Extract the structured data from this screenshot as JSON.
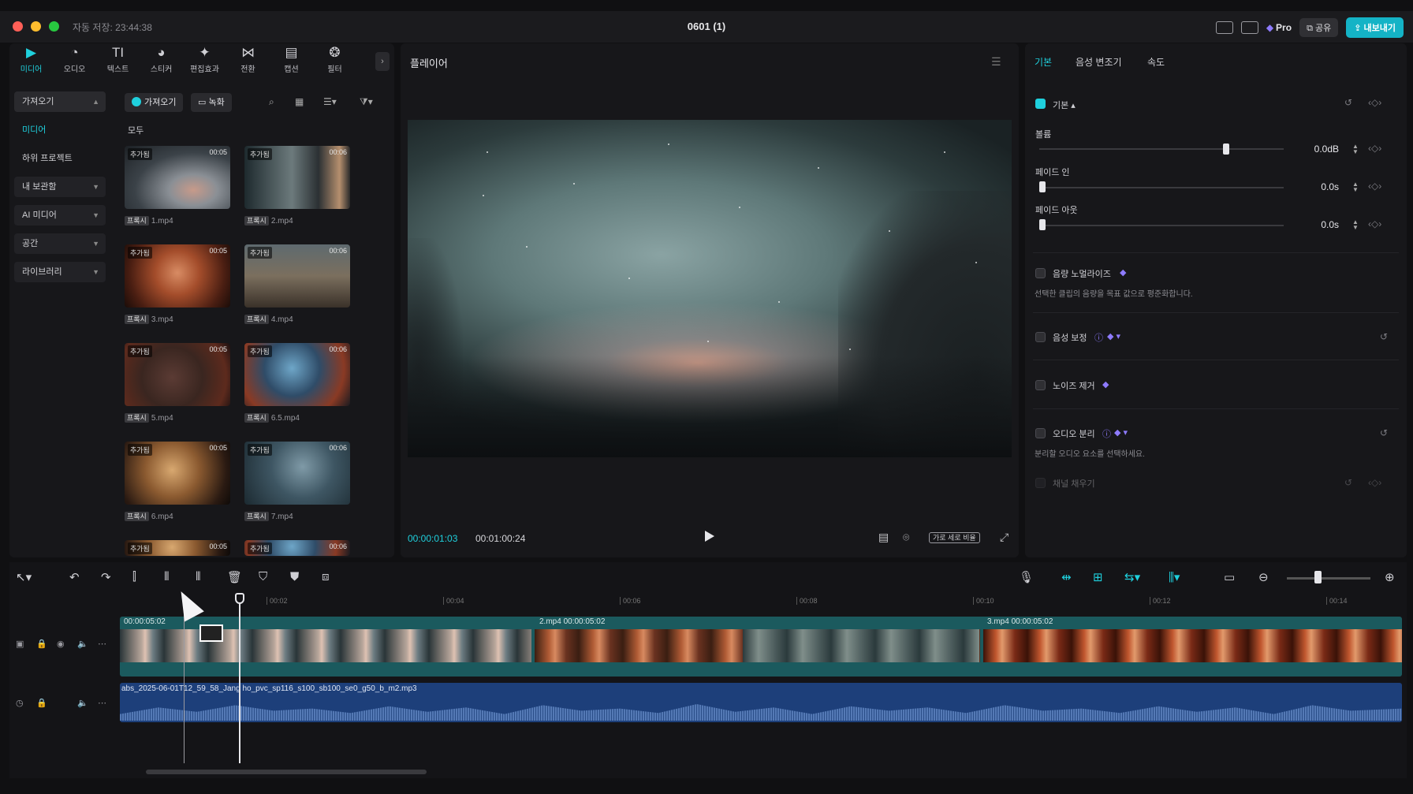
{
  "titlebar": {
    "autosave": "자동 저장: 23:44:38",
    "title": "0601 (1)",
    "pro": "Pro",
    "share": "공유",
    "export": "내보내기"
  },
  "tools": [
    {
      "label": "미디어",
      "icon": "▶"
    },
    {
      "label": "오디오",
      "icon": "◔"
    },
    {
      "label": "텍스트",
      "icon": "TI"
    },
    {
      "label": "스티커",
      "icon": "◕"
    },
    {
      "label": "편집효과",
      "icon": "✦"
    },
    {
      "label": "전환",
      "icon": "⋈"
    },
    {
      "label": "캡션",
      "icon": "▤"
    },
    {
      "label": "필터",
      "icon": "❂"
    }
  ],
  "nav": {
    "import": "가져오기",
    "media": "미디어",
    "sub_project": "하위 프로젝트",
    "my_library": "내 보관함",
    "ai_media": "AI 미디어",
    "space": "공간",
    "library": "라이브러리"
  },
  "media_head": {
    "import_btn": "가져오기",
    "record_btn": "녹화",
    "filter_all": "모두"
  },
  "media_items": [
    {
      "badge": "추가됨",
      "duration": "00:05",
      "tag": "프록시",
      "name": "1.mp4"
    },
    {
      "badge": "추가됨",
      "duration": "00:06",
      "tag": "프록시",
      "name": "2.mp4"
    },
    {
      "badge": "추가됨",
      "duration": "00:05",
      "tag": "프록시",
      "name": "3.mp4"
    },
    {
      "badge": "추가됨",
      "duration": "00:06",
      "tag": "프록시",
      "name": "4.mp4"
    },
    {
      "badge": "추가됨",
      "duration": "00:05",
      "tag": "프록시",
      "name": "5.mp4"
    },
    {
      "badge": "추가됨",
      "duration": "00:06",
      "tag": "프록시",
      "name": "6.5.mp4"
    },
    {
      "badge": "추가됨",
      "duration": "00:05",
      "tag": "프록시",
      "name": "6.mp4"
    },
    {
      "badge": "추가됨",
      "duration": "00:06",
      "tag": "프록시",
      "name": "7.mp4"
    },
    {
      "badge": "추가됨",
      "duration": "00:05"
    },
    {
      "badge": "추가됨",
      "duration": "00:06"
    }
  ],
  "player": {
    "title": "플레이어",
    "current_time": "00:00:01:03",
    "total_time": "00:01:00:24",
    "ratio": "가로 세로 비율"
  },
  "right": {
    "tabs": [
      "기본",
      "음성 변조기",
      "속도"
    ],
    "basic_label": "기본",
    "volume_label": "볼륨",
    "volume_value": "0.0dB",
    "fade_in_label": "페이드 인",
    "fade_in_value": "0.0s",
    "fade_out_label": "페이드 아웃",
    "fade_out_value": "0.0s",
    "normalize_label": "음량 노멀라이즈",
    "normalize_desc": "선택한 클립의 음량을 목표 값으로 평준화합니다.",
    "voice_enhance_label": "음성 보정",
    "noise_label": "노이즈 제거",
    "audio_sep_label": "오디오 분리",
    "audio_sep_desc": "분리할 오디오 요소를 선택하세요.",
    "channel_label": "채널 채우기",
    "volume_level": 0.75,
    "fade_in_level": 0,
    "fade_out_level": 0
  },
  "timeline": {
    "ticks": [
      "00:02",
      "00:04",
      "00:06",
      "00:08",
      "00:10",
      "00:12",
      "00:14"
    ],
    "clip1_hdr": "00:00:05:02",
    "clip2_hdr": "2.mp4  00:00:05:02",
    "clip3_hdr": "3.mp4  00:00:05:02",
    "audio_name": "abs_2025-06-01T12_59_58_Jang ho_pvc_sp116_s100_sb100_se0_g50_b_m2.mp3"
  },
  "colors": {
    "accent": "#1fd0dd",
    "video_track": "#1b5a5e",
    "audio_track": "#1d3f7a"
  }
}
